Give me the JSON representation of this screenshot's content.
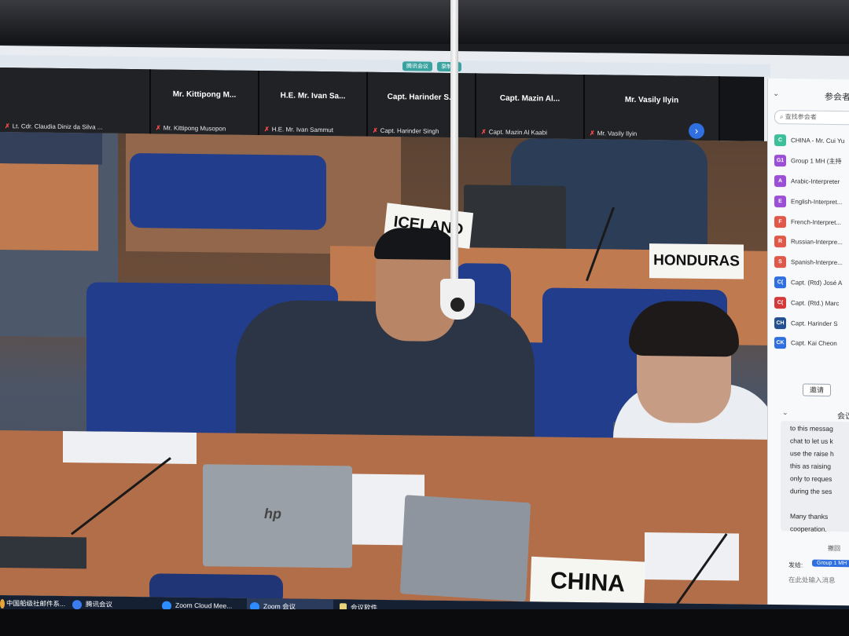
{
  "meeting_tags": [
    "腾讯会议",
    "录制中"
  ],
  "gallery": {
    "tiles": [
      {
        "display": "",
        "sub": "Lt. Cdr. Claudia Diniz da Silva ..."
      },
      {
        "display": "Mr. Kittipong M...",
        "sub": "Mr. Kittipong Musopon"
      },
      {
        "display": "H.E. Mr. Ivan Sa...",
        "sub": "H.E. Mr. Ivan Sammut"
      },
      {
        "display": "Capt. Harinder S...",
        "sub": "Capt. Harinder Singh"
      },
      {
        "display": "Capt. Mazin Al...",
        "sub": "Capt. Mazin Al Kaabi"
      },
      {
        "display": "Mr. Vasily Ilyin",
        "sub": "Mr. Vasily Ilyin"
      }
    ],
    "next_icon": "›"
  },
  "placards": {
    "iceland": "ICELAND",
    "honduras": "HONDURAS",
    "china": "CHINA"
  },
  "laptop_logo": "hp",
  "participants_panel": {
    "title": "参会者",
    "collapse_icon": "⌄",
    "search_placeholder": "查找参会者",
    "items": [
      {
        "initials": "C",
        "color": "#3dbf9c",
        "name": "CHINA - Mr. Cui Yu"
      },
      {
        "initials": "G1",
        "color": "#9b4fd6",
        "name": "Group 1 MH (主持"
      },
      {
        "initials": "A",
        "color": "#9b4fd6",
        "name": "Arabic-Interpreter"
      },
      {
        "initials": "E",
        "color": "#9b4fd6",
        "name": "English-Interpret..."
      },
      {
        "initials": "F",
        "color": "#e0584a",
        "name": "French-Interpret..."
      },
      {
        "initials": "R",
        "color": "#e0584a",
        "name": "Russian-Interpre..."
      },
      {
        "initials": "S",
        "color": "#e0584a",
        "name": "Spanish-Interpre..."
      },
      {
        "initials": "C(",
        "color": "#2f6fe0",
        "name": "Capt. (Rtd) José A"
      },
      {
        "initials": "C(",
        "color": "#d43a3a",
        "name": "Capt. (Rtd.) Marc"
      },
      {
        "initials": "CH",
        "color": "#23508f",
        "name": "Capt. Harinder S"
      },
      {
        "initials": "CK",
        "color": "#2f6fe0",
        "name": "Capt. Kai Cheon"
      }
    ],
    "invite_label": "邀请"
  },
  "chat_panel": {
    "title": "会议",
    "collapse_icon": "⌄",
    "lines": [
      "to this messag",
      "chat to let us k",
      "use the raise h",
      "this as raising",
      "only to reques",
      "during the ses",
      "Many thanks",
      "cooperation."
    ],
    "more_label": "撤回",
    "send_to_label": "发给:",
    "send_to_value": "Group 1 MH",
    "input_placeholder": "在此处输入消息",
    "icons": "▭ ⊡ ☺"
  },
  "taskbar": {
    "items": [
      {
        "label": "中国船级社邮件系...",
        "icon_color": "#e8a33a"
      },
      {
        "label": "腾讯会议",
        "icon_color": "#3b7cf0"
      },
      {
        "label": "Zoom Cloud Mee...",
        "icon_color": "#2d8cff"
      },
      {
        "label": "Zoom 会议",
        "icon_color": "#2d8cff"
      },
      {
        "label": "会议软件",
        "icon_color": "#e8d27a"
      }
    ],
    "tray": "⌃  ◧"
  }
}
